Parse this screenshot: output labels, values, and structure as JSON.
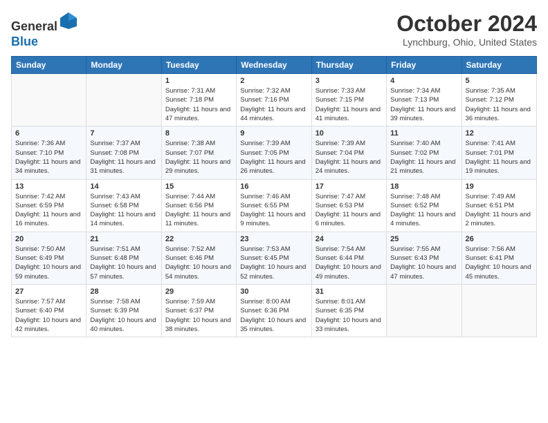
{
  "header": {
    "logo_line1": "General",
    "logo_line2": "Blue",
    "month": "October 2024",
    "location": "Lynchburg, Ohio, United States"
  },
  "days_of_week": [
    "Sunday",
    "Monday",
    "Tuesday",
    "Wednesday",
    "Thursday",
    "Friday",
    "Saturday"
  ],
  "weeks": [
    [
      {
        "day": "",
        "info": ""
      },
      {
        "day": "",
        "info": ""
      },
      {
        "day": "1",
        "info": "Sunrise: 7:31 AM\nSunset: 7:18 PM\nDaylight: 11 hours and 47 minutes."
      },
      {
        "day": "2",
        "info": "Sunrise: 7:32 AM\nSunset: 7:16 PM\nDaylight: 11 hours and 44 minutes."
      },
      {
        "day": "3",
        "info": "Sunrise: 7:33 AM\nSunset: 7:15 PM\nDaylight: 11 hours and 41 minutes."
      },
      {
        "day": "4",
        "info": "Sunrise: 7:34 AM\nSunset: 7:13 PM\nDaylight: 11 hours and 39 minutes."
      },
      {
        "day": "5",
        "info": "Sunrise: 7:35 AM\nSunset: 7:12 PM\nDaylight: 11 hours and 36 minutes."
      }
    ],
    [
      {
        "day": "6",
        "info": "Sunrise: 7:36 AM\nSunset: 7:10 PM\nDaylight: 11 hours and 34 minutes."
      },
      {
        "day": "7",
        "info": "Sunrise: 7:37 AM\nSunset: 7:08 PM\nDaylight: 11 hours and 31 minutes."
      },
      {
        "day": "8",
        "info": "Sunrise: 7:38 AM\nSunset: 7:07 PM\nDaylight: 11 hours and 29 minutes."
      },
      {
        "day": "9",
        "info": "Sunrise: 7:39 AM\nSunset: 7:05 PM\nDaylight: 11 hours and 26 minutes."
      },
      {
        "day": "10",
        "info": "Sunrise: 7:39 AM\nSunset: 7:04 PM\nDaylight: 11 hours and 24 minutes."
      },
      {
        "day": "11",
        "info": "Sunrise: 7:40 AM\nSunset: 7:02 PM\nDaylight: 11 hours and 21 minutes."
      },
      {
        "day": "12",
        "info": "Sunrise: 7:41 AM\nSunset: 7:01 PM\nDaylight: 11 hours and 19 minutes."
      }
    ],
    [
      {
        "day": "13",
        "info": "Sunrise: 7:42 AM\nSunset: 6:59 PM\nDaylight: 11 hours and 16 minutes."
      },
      {
        "day": "14",
        "info": "Sunrise: 7:43 AM\nSunset: 6:58 PM\nDaylight: 11 hours and 14 minutes."
      },
      {
        "day": "15",
        "info": "Sunrise: 7:44 AM\nSunset: 6:56 PM\nDaylight: 11 hours and 11 minutes."
      },
      {
        "day": "16",
        "info": "Sunrise: 7:46 AM\nSunset: 6:55 PM\nDaylight: 11 hours and 9 minutes."
      },
      {
        "day": "17",
        "info": "Sunrise: 7:47 AM\nSunset: 6:53 PM\nDaylight: 11 hours and 6 minutes."
      },
      {
        "day": "18",
        "info": "Sunrise: 7:48 AM\nSunset: 6:52 PM\nDaylight: 11 hours and 4 minutes."
      },
      {
        "day": "19",
        "info": "Sunrise: 7:49 AM\nSunset: 6:51 PM\nDaylight: 11 hours and 2 minutes."
      }
    ],
    [
      {
        "day": "20",
        "info": "Sunrise: 7:50 AM\nSunset: 6:49 PM\nDaylight: 10 hours and 59 minutes."
      },
      {
        "day": "21",
        "info": "Sunrise: 7:51 AM\nSunset: 6:48 PM\nDaylight: 10 hours and 57 minutes."
      },
      {
        "day": "22",
        "info": "Sunrise: 7:52 AM\nSunset: 6:46 PM\nDaylight: 10 hours and 54 minutes."
      },
      {
        "day": "23",
        "info": "Sunrise: 7:53 AM\nSunset: 6:45 PM\nDaylight: 10 hours and 52 minutes."
      },
      {
        "day": "24",
        "info": "Sunrise: 7:54 AM\nSunset: 6:44 PM\nDaylight: 10 hours and 49 minutes."
      },
      {
        "day": "25",
        "info": "Sunrise: 7:55 AM\nSunset: 6:43 PM\nDaylight: 10 hours and 47 minutes."
      },
      {
        "day": "26",
        "info": "Sunrise: 7:56 AM\nSunset: 6:41 PM\nDaylight: 10 hours and 45 minutes."
      }
    ],
    [
      {
        "day": "27",
        "info": "Sunrise: 7:57 AM\nSunset: 6:40 PM\nDaylight: 10 hours and 42 minutes."
      },
      {
        "day": "28",
        "info": "Sunrise: 7:58 AM\nSunset: 6:39 PM\nDaylight: 10 hours and 40 minutes."
      },
      {
        "day": "29",
        "info": "Sunrise: 7:59 AM\nSunset: 6:37 PM\nDaylight: 10 hours and 38 minutes."
      },
      {
        "day": "30",
        "info": "Sunrise: 8:00 AM\nSunset: 6:36 PM\nDaylight: 10 hours and 35 minutes."
      },
      {
        "day": "31",
        "info": "Sunrise: 8:01 AM\nSunset: 6:35 PM\nDaylight: 10 hours and 33 minutes."
      },
      {
        "day": "",
        "info": ""
      },
      {
        "day": "",
        "info": ""
      }
    ]
  ]
}
